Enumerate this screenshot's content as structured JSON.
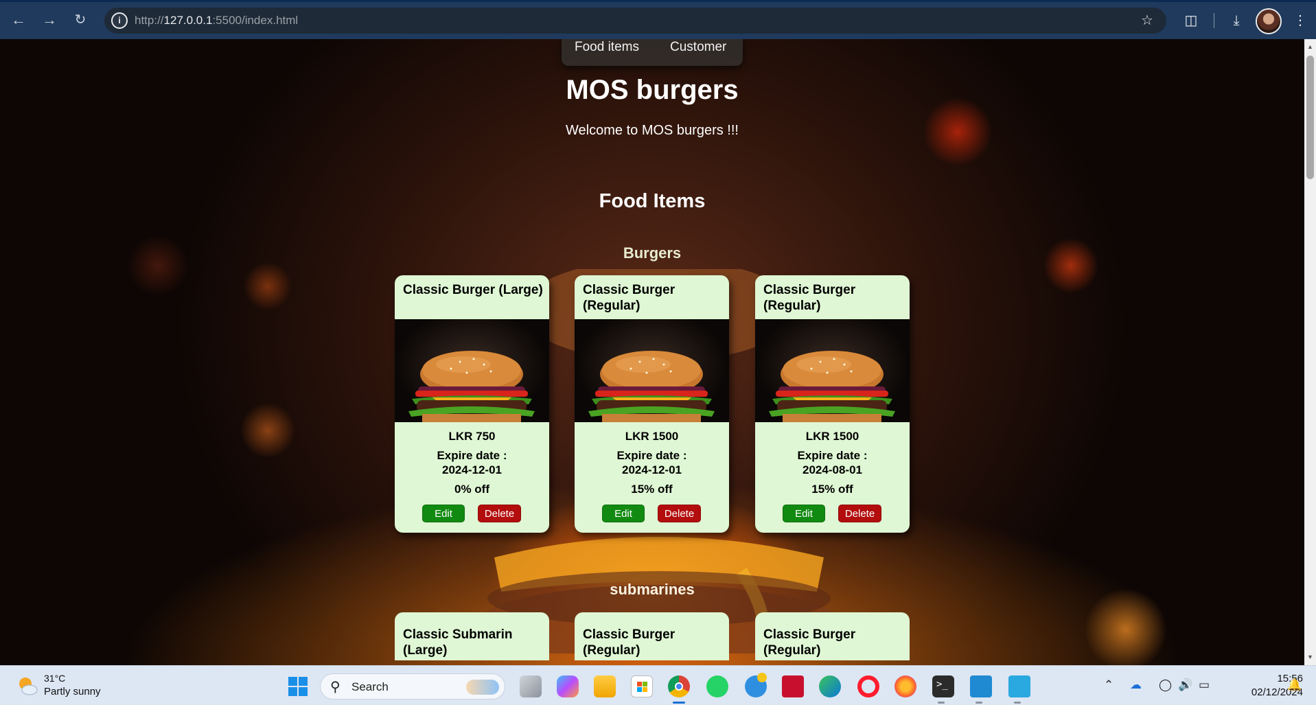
{
  "browser": {
    "url_prefix": "http://",
    "url_host": "127.0.0.1",
    "url_rest": ":5500/index.html"
  },
  "nav": {
    "food_items": "Food items",
    "customer": "Customer"
  },
  "header": {
    "title": "MOS burgers",
    "welcome": "Welcome to MOS burgers !!!"
  },
  "main": {
    "section_title": "Food Items",
    "categories": [
      {
        "name": "Burgers",
        "items": [
          {
            "name": "Classic Burger (Large)",
            "price": "LKR 750",
            "expire_label": "Expire date :",
            "expire_date": "2024-12-01",
            "discount": "0% off",
            "edit": "Edit",
            "delete": "Delete"
          },
          {
            "name": "Classic Burger (Regular)",
            "price": "LKR 1500",
            "expire_label": "Expire date :",
            "expire_date": "2024-12-01",
            "discount": "15% off",
            "edit": "Edit",
            "delete": "Delete"
          },
          {
            "name": "Classic Burger (Regular)",
            "price": "LKR 1500",
            "expire_label": "Expire date :",
            "expire_date": "2024-08-01",
            "discount": "15% off",
            "edit": "Edit",
            "delete": "Delete"
          }
        ]
      },
      {
        "name": "submarines",
        "items": [
          {
            "name": "Classic Submarin (Large)"
          },
          {
            "name": "Classic Burger (Regular)"
          },
          {
            "name": "Classic Burger (Regular)"
          }
        ]
      }
    ]
  },
  "taskbar": {
    "weather_temp": "31°C",
    "weather_desc": "Partly sunny",
    "search": "Search",
    "time": "15:56",
    "date": "02/12/2024"
  },
  "colors": {
    "card_bg": "#dff7d4",
    "edit_button": "#118a11",
    "delete_button": "#b30d0d",
    "category_burgers": "#e8ecd0",
    "category_submarines": "#fff3e0"
  }
}
